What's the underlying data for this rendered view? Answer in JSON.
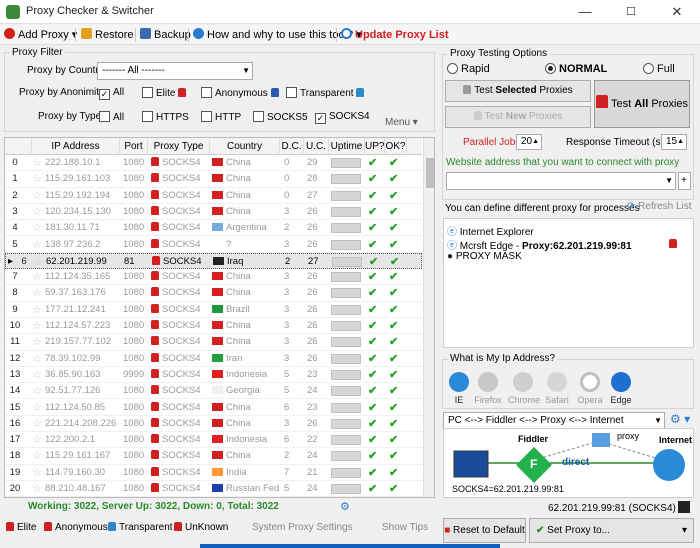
{
  "window": {
    "title": "Proxy Checker & Switcher",
    "min": "—",
    "max": "☐",
    "close": "✕"
  },
  "toolbar": {
    "add_proxy": "Add Proxy",
    "restore": "Restore",
    "backup": "Backup",
    "how_why": "How and why to use this tool?",
    "update_list": "Update Proxy List"
  },
  "filter": {
    "group_label": "Proxy Filter",
    "by_country_label": "Proxy by Country:",
    "country_value": "------- All -------",
    "by_anonimity_label": "Proxy by Anonimity:",
    "anon_all": "All",
    "anon_elite": "Elite",
    "anon_anonymous": "Anonymous",
    "anon_transparent": "Transparent",
    "by_type_label": "Proxy by Type:",
    "type_all": "All",
    "type_https": "HTTPS",
    "type_http": "HTTP",
    "type_socks5": "SOCKS5",
    "type_socks4": "SOCKS4",
    "menu": "Menu"
  },
  "table": {
    "headers": [
      "IP Address",
      "Port",
      "Proxy Type",
      "Country",
      "D.C.",
      "U.C.",
      "Uptime",
      "UP?",
      "OK?"
    ],
    "rows": [
      {
        "n": "0",
        "ip": "222.188.10.1",
        "port": "1080",
        "type": "SOCKS4",
        "country": "China",
        "dc": "0",
        "uc": "29",
        "flag": "#d21f1f"
      },
      {
        "n": "1",
        "ip": "115.29.161.103",
        "port": "1080",
        "type": "SOCKS4",
        "country": "China",
        "dc": "0",
        "uc": "28",
        "flag": "#d21f1f"
      },
      {
        "n": "2",
        "ip": "115.29.192.194",
        "port": "1080",
        "type": "SOCKS4",
        "country": "China",
        "dc": "0",
        "uc": "27",
        "flag": "#d21f1f"
      },
      {
        "n": "3",
        "ip": "120.234.15.130",
        "port": "1080",
        "type": "SOCKS4",
        "country": "China",
        "dc": "3",
        "uc": "26",
        "flag": "#d21f1f"
      },
      {
        "n": "4",
        "ip": "181.30.11.71",
        "port": "1080",
        "type": "SOCKS4",
        "country": "Argentina",
        "dc": "2",
        "uc": "26",
        "flag": "#75aadb"
      },
      {
        "n": "5",
        "ip": "138.97.236.2",
        "port": "1080",
        "type": "SOCKS4",
        "country": "?",
        "dc": "3",
        "uc": "26",
        "flag": "#ffffff"
      },
      {
        "n": "6",
        "ip": "62.201.219.99",
        "port": "81",
        "type": "SOCKS4",
        "country": "Iraq",
        "dc": "2",
        "uc": "27",
        "flag": "#222222"
      },
      {
        "n": "7",
        "ip": "112.124.35.165",
        "port": "1080",
        "type": "SOCKS4",
        "country": "China",
        "dc": "3",
        "uc": "26",
        "flag": "#d21f1f"
      },
      {
        "n": "8",
        "ip": "59.37.163.176",
        "port": "1080",
        "type": "SOCKS4",
        "country": "China",
        "dc": "3",
        "uc": "26",
        "flag": "#d21f1f"
      },
      {
        "n": "9",
        "ip": "177.21.12.241",
        "port": "1080",
        "type": "SOCKS4",
        "country": "Brazil",
        "dc": "3",
        "uc": "26",
        "flag": "#1a9a3a"
      },
      {
        "n": "10",
        "ip": "112.124.57.223",
        "port": "1080",
        "type": "SOCKS4",
        "country": "China",
        "dc": "3",
        "uc": "26",
        "flag": "#d21f1f"
      },
      {
        "n": "11",
        "ip": "219.157.77.102",
        "port": "1080",
        "type": "SOCKS4",
        "country": "China",
        "dc": "3",
        "uc": "26",
        "flag": "#d21f1f"
      },
      {
        "n": "12",
        "ip": "78.39.102.99",
        "port": "1080",
        "type": "SOCKS4",
        "country": "Iran",
        "dc": "3",
        "uc": "26",
        "flag": "#239f40"
      },
      {
        "n": "13",
        "ip": "36.85.90.163",
        "port": "9999",
        "type": "SOCKS4",
        "country": "Indonesia",
        "dc": "5",
        "uc": "23",
        "flag": "#e02020"
      },
      {
        "n": "14",
        "ip": "92.51.77.126",
        "port": "1080",
        "type": "SOCKS4",
        "country": "Georgia",
        "dc": "5",
        "uc": "24",
        "flag": "#f0f0f0"
      },
      {
        "n": "15",
        "ip": "112.124.50.85",
        "port": "1080",
        "type": "SOCKS4",
        "country": "China",
        "dc": "6",
        "uc": "23",
        "flag": "#d21f1f"
      },
      {
        "n": "16",
        "ip": "221.214.208.226",
        "port": "1080",
        "type": "SOCKS4",
        "country": "China",
        "dc": "3",
        "uc": "26",
        "flag": "#d21f1f"
      },
      {
        "n": "17",
        "ip": "122.200.2.1",
        "port": "1080",
        "type": "SOCKS4",
        "country": "Indonesia",
        "dc": "6",
        "uc": "22",
        "flag": "#e02020"
      },
      {
        "n": "18",
        "ip": "115.29.161.167",
        "port": "1080",
        "type": "SOCKS4",
        "country": "China",
        "dc": "2",
        "uc": "24",
        "flag": "#d21f1f"
      },
      {
        "n": "19",
        "ip": "114.79.160.30",
        "port": "1080",
        "type": "SOCKS4",
        "country": "India",
        "dc": "7",
        "uc": "21",
        "flag": "#ff9933"
      },
      {
        "n": "20",
        "ip": "88.210.48.167",
        "port": "1080",
        "type": "SOCKS4",
        "country": "Russian Fed...",
        "dc": "5",
        "uc": "24",
        "flag": "#1c3faa"
      }
    ]
  },
  "status": {
    "text": "Working: 3022, Server Up: 3022, Down: 0, Total: 3022"
  },
  "legend": {
    "elite": "Elite",
    "anonymous": "Anonymous",
    "transparent": "Transparent",
    "unknown": "UnKnown",
    "system_settings": "System Proxy Settings",
    "show_tips": "Show Tips"
  },
  "testing": {
    "group_label": "Proxy Testing Options",
    "rapid": "Rapid",
    "normal": "NORMAL",
    "full": "Full",
    "test_selected_pre": "Test ",
    "test_selected_bold": "Selected",
    "test_selected_post": " Proxies",
    "test_new_pre": "Test ",
    "test_new_bold": "New",
    "test_new_post": " Proxies",
    "test_all_pre": "Test ",
    "test_all_bold": "All",
    "test_all_post": " Proxies",
    "parallel_label": "Parallel Jobs:",
    "parallel_value": "20",
    "timeout_label": "Response Timeout (sec):",
    "timeout_value": "15",
    "website_label": "Website address that you want to connect with proxy",
    "website_value": ""
  },
  "processes": {
    "label": "You can define different proxy for processes",
    "refresh": "Refresh List",
    "items": [
      {
        "name": "Internet Explorer",
        "proxy": ""
      },
      {
        "name": "Mcrsft Edge - ",
        "proxy": "Proxy:62.201.219.99:81"
      },
      {
        "name": "PROXY MASK",
        "proxy": ""
      }
    ]
  },
  "myip": {
    "label": "What is My Ip Address?",
    "browsers": [
      "IE",
      "Firefox",
      "Chrome",
      "Safari",
      "Opera",
      "Edge"
    ]
  },
  "chain": {
    "value": "PC <--> Fiddler <--> Proxy <--> Internet",
    "fiddler": "Fiddler",
    "fiddler_letter": "F",
    "proxy": "proxy",
    "internet": "Internet",
    "direct": "direct",
    "socks": "SOCKS4=62.201.219.99:81"
  },
  "current_proxy": "62.201.219.99:81 (SOCKS4)",
  "actions": {
    "reset": "Reset to Default",
    "set_proxy": "Set Proxy to..."
  },
  "colors": {
    "accent": "#d02020",
    "green": "#2a8a2a",
    "blue": "#1060c0"
  }
}
